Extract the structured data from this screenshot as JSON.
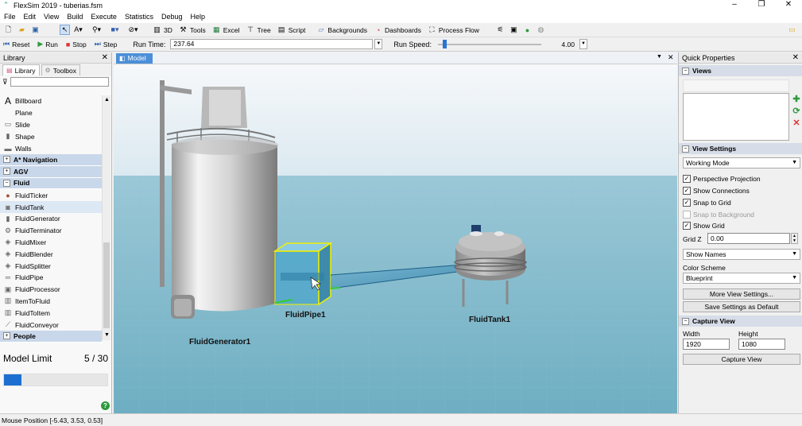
{
  "window": {
    "title": "FlexSim 2019 - tuberias.fsm"
  },
  "menu": [
    "File",
    "Edit",
    "View",
    "Build",
    "Execute",
    "Statistics",
    "Debug",
    "Help"
  ],
  "toolbar": {
    "view_3d": "3D",
    "tools": "Tools",
    "excel": "Excel",
    "tree": "Tree",
    "script": "Script",
    "backgrounds": "Backgrounds",
    "dashboards": "Dashboards",
    "process_flow": "Process Flow"
  },
  "run_controls": {
    "reset": "Reset",
    "run": "Run",
    "stop": "Stop",
    "step": "Step",
    "run_time_label": "Run Time:",
    "run_time_value": "237.64",
    "run_speed_label": "Run Speed:",
    "run_speed_value": "4.00"
  },
  "library": {
    "header": "Library",
    "tabs": [
      "Library",
      "Toolbox"
    ],
    "items_top": [
      {
        "label": "Billboard",
        "icon": "billboard-icon"
      },
      {
        "label": "Plane",
        "icon": "plane-icon"
      },
      {
        "label": "Slide",
        "icon": "slide-icon"
      },
      {
        "label": "Shape",
        "icon": "shape-icon"
      },
      {
        "label": "Walls",
        "icon": "walls-icon"
      }
    ],
    "groups": {
      "navigation": "A* Navigation",
      "agv": "AGV",
      "fluid": "Fluid",
      "people": "People"
    },
    "fluid_items": [
      "FluidTicker",
      "FluidTank",
      "FluidGenerator",
      "FluidTerminator",
      "FluidMixer",
      "FluidBlender",
      "FluidSplitter",
      "FluidPipe",
      "FluidProcessor",
      "ItemToFluid",
      "FluidToItem",
      "FluidConveyor"
    ],
    "selected_item": "FluidTank",
    "model_limit_label": "Model Limit",
    "model_limit_value": "5 / 30",
    "model_limit_fraction": 0.167
  },
  "model_view": {
    "tab": "Model",
    "labels": {
      "generator": "FluidGenerator1",
      "pipe": "FluidPipe1",
      "tank": "FluidTank1"
    }
  },
  "quick_properties": {
    "header": "Quick Properties",
    "views_section": "Views",
    "view_settings_section": "View Settings",
    "mode": "Working Mode",
    "checks": [
      {
        "label": "Perspective Projection",
        "checked": true,
        "disabled": false
      },
      {
        "label": "Show Connections",
        "checked": true,
        "disabled": false
      },
      {
        "label": "Snap to Grid",
        "checked": true,
        "disabled": false
      },
      {
        "label": "Snap to Background",
        "checked": false,
        "disabled": true
      },
      {
        "label": "Show Grid",
        "checked": true,
        "disabled": false
      }
    ],
    "grid_z_label": "Grid Z",
    "grid_z_value": "0.00",
    "show_names": "Show Names",
    "color_scheme_label": "Color Scheme",
    "color_scheme_value": "Blueprint",
    "more_view_settings": "More View Settings...",
    "save_default": "Save Settings as Default",
    "capture_section": "Capture View",
    "width_label": "Width",
    "height_label": "Height",
    "width_value": "1920",
    "height_value": "1080",
    "capture_button": "Capture View"
  },
  "status": {
    "mouse_position": "Mouse Position [-5.43, 3.53, 0.53]"
  },
  "colors": {
    "sky_top": "#f4f7f9",
    "floor": "#7fb5c9",
    "accent": "#1c6fd1",
    "selection": "#f0f000"
  }
}
